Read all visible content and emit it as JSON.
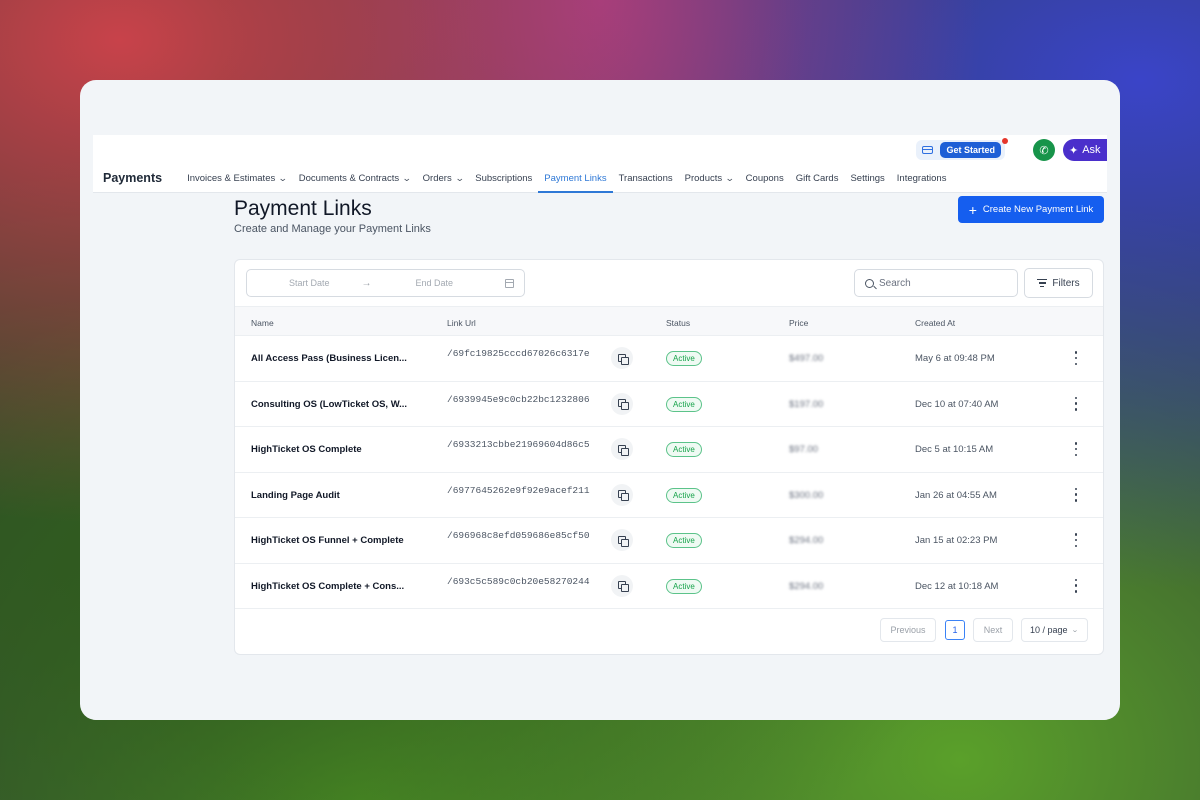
{
  "header": {
    "get_started": "Get Started",
    "ask": "Ask",
    "brand": "Payments",
    "nav": [
      {
        "label": "Invoices & Estimates",
        "dropdown": true
      },
      {
        "label": "Documents & Contracts",
        "dropdown": true
      },
      {
        "label": "Orders",
        "dropdown": true
      },
      {
        "label": "Subscriptions",
        "dropdown": false
      },
      {
        "label": "Payment Links",
        "dropdown": false,
        "active": true
      },
      {
        "label": "Transactions",
        "dropdown": false
      },
      {
        "label": "Products",
        "dropdown": true
      },
      {
        "label": "Coupons",
        "dropdown": false
      },
      {
        "label": "Gift Cards",
        "dropdown": false
      },
      {
        "label": "Settings",
        "dropdown": false
      },
      {
        "label": "Integrations",
        "dropdown": false
      }
    ]
  },
  "page": {
    "title": "Payment Links",
    "subtitle": "Create and Manage your Payment Links",
    "create_button": "Create New Payment Link"
  },
  "filters": {
    "start_placeholder": "Start Date",
    "end_placeholder": "End Date",
    "search_placeholder": "Search",
    "filters_label": "Filters"
  },
  "table": {
    "columns": [
      "Name",
      "Link Url",
      "Status",
      "Price",
      "Created At"
    ],
    "rows": [
      {
        "name": "All Access Pass (Business Licen...",
        "url": "/69fc19825cccd67026c6317e",
        "status": "Active",
        "price": "$497.00",
        "created": "May 6 at 09:48 PM"
      },
      {
        "name": "Consulting OS (LowTicket OS, W...",
        "url": "/6939945e9c0cb22bc1232806",
        "status": "Active",
        "price": "$197.00",
        "created": "Dec 10 at 07:40 AM"
      },
      {
        "name": "HighTicket OS Complete",
        "url": "/6933213cbbe21969604d86c5",
        "status": "Active",
        "price": "$97.00",
        "created": "Dec 5 at 10:15 AM"
      },
      {
        "name": "Landing Page Audit",
        "url": "/6977645262e9f92e9acef211",
        "status": "Active",
        "price": "$300.00",
        "created": "Jan 26 at 04:55 AM"
      },
      {
        "name": "HighTicket OS Funnel + Complete",
        "url": "/696968c8efd059686e85cf50",
        "status": "Active",
        "price": "$294.00",
        "created": "Jan 15 at 02:23 PM"
      },
      {
        "name": "HighTicket OS Complete + Cons...",
        "url": "/693c5c589c0cb20e58270244",
        "status": "Active",
        "price": "$294.00",
        "created": "Dec 12 at 10:18 AM"
      }
    ]
  },
  "pagination": {
    "previous": "Previous",
    "current_page": "1",
    "next": "Next",
    "page_size": "10 / page"
  },
  "colors": {
    "accent": "#155eef",
    "active_tab": "#2e78d6",
    "status_active": "#16a34a",
    "phone": "#17944a",
    "ask": "#4a2fcb"
  }
}
